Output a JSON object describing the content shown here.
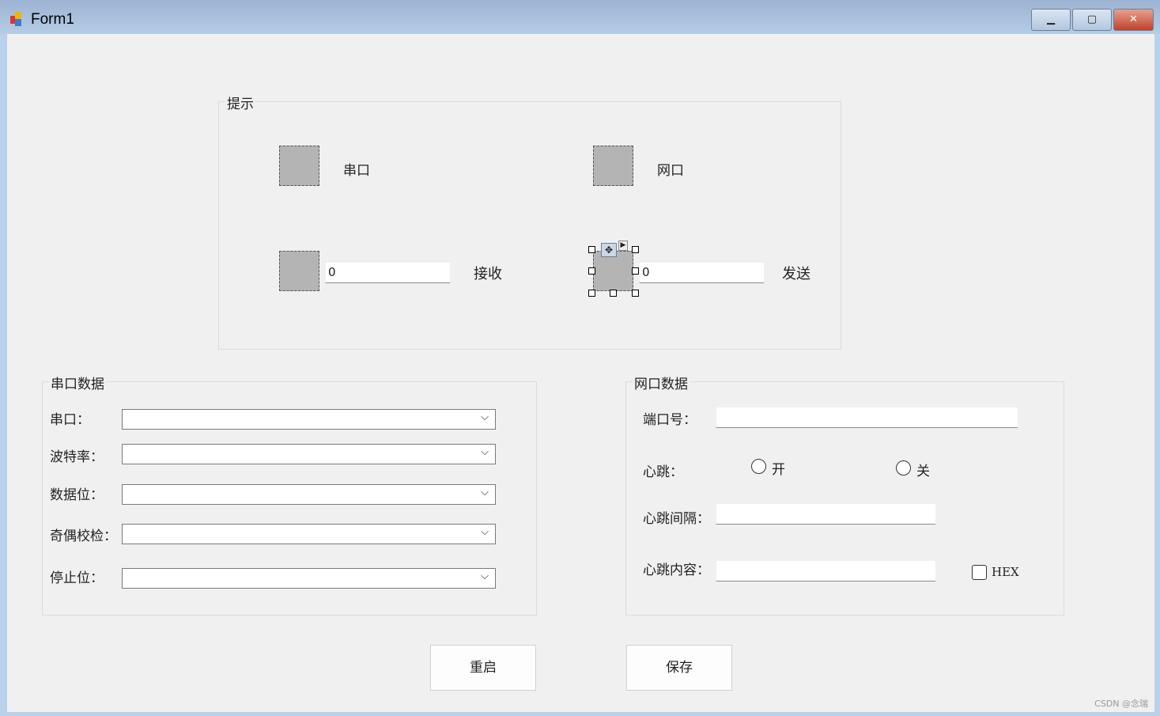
{
  "window": {
    "title": "Form1",
    "minimize": "▁",
    "maximize": "▢",
    "close": "✕"
  },
  "hint": {
    "title": "提示",
    "serial": "串口",
    "network": "网口",
    "receive_count": "0",
    "receive": "接收",
    "send_count": "0",
    "send": "发送"
  },
  "serial": {
    "title": "串口数据",
    "fields": [
      {
        "label": "串口："
      },
      {
        "label": "波特率："
      },
      {
        "label": "数据位："
      },
      {
        "label": "奇偶校检："
      },
      {
        "label": "停止位："
      }
    ]
  },
  "network": {
    "title": "网口数据",
    "port_label": "端口号：",
    "port_value": "",
    "heartbeat_label": "心跳：",
    "on": "开",
    "off": "关",
    "interval_label": "心跳间隔：",
    "interval_value": "",
    "content_label": "心跳内容：",
    "content_value": "",
    "hex": "HEX"
  },
  "buttons": {
    "restart": "重启",
    "save": "保存"
  },
  "watermark": "CSDN @念瑞"
}
